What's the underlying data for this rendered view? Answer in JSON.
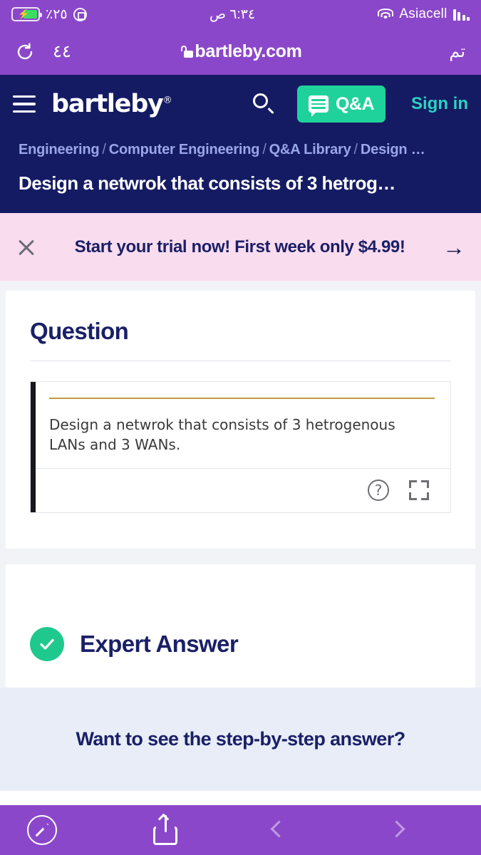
{
  "status_bar": {
    "battery_percent": "٪٢٥",
    "battery_state_icon": "battery-charging-icon",
    "rotation_lock_icon": "rotation-lock-icon",
    "time": "٦:٣٤ ص",
    "wifi_icon": "wifi-icon",
    "carrier": "Asiacell",
    "signal_icon": "signal-bars-icon"
  },
  "browser": {
    "reload_icon": "reload-icon",
    "tab_count": "٤٤",
    "lock_icon": "lock-icon",
    "url": "bartleby.com",
    "done_label": "تم"
  },
  "nav": {
    "menu_icon": "hamburger-menu-icon",
    "logo": "bartleby",
    "logo_mark": "®",
    "search_icon": "search-icon",
    "qa_icon": "speech-bubble-icon",
    "qa_label": "Q&A",
    "signin_label": "Sign in",
    "accent_green": "#1FD29B",
    "signin_color": "#2BD3C0",
    "background": "#151B63"
  },
  "breadcrumb": {
    "items": [
      "Engineering",
      "Computer Engineering",
      "Q&A Library",
      "Design …"
    ],
    "separator": "/"
  },
  "page_title": "Design a netwrok that consists of 3 hetrog…",
  "promo": {
    "close_icon": "close-icon",
    "text": "Start your trial now! First week only $4.99!",
    "arrow_icon": "arrow-right-icon",
    "background": "#FADCEF",
    "text_color": "#1A1F66"
  },
  "question_card": {
    "heading": "Question",
    "body": "Design a netwrok that consists of 3 hetrogenous LANs and 3 WANs.",
    "accent_bar_color": "#17181C",
    "rule_color": "#C39B3E",
    "help_icon": "help-circle-icon",
    "help_glyph": "?",
    "expand_icon": "expand-fullscreen-icon"
  },
  "answer_card": {
    "check_icon": "check-circle-icon",
    "title": "Expert Answer",
    "check_color": "#1FC98E"
  },
  "steps_section": {
    "text": "Want to see the step-by-step answer?",
    "background": "#E9EDF8"
  },
  "bottom_toolbar": {
    "safari_icon": "safari-compass-icon",
    "share_icon": "share-icon",
    "back_icon": "chevron-left-icon",
    "forward_icon": "chevron-right-icon",
    "background": "#8B47C9"
  }
}
